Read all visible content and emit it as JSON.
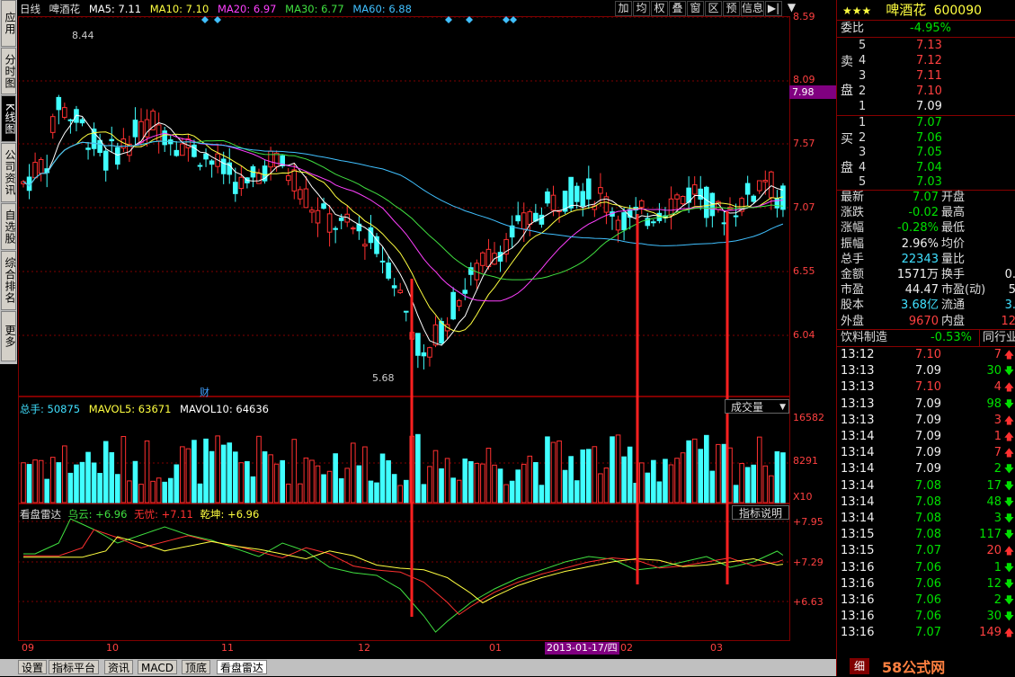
{
  "left_tabs": [
    "应用",
    "分时图",
    "K线图",
    "公司资讯",
    "自选股",
    "综合排名",
    "更多"
  ],
  "chart": {
    "period_label": "日线",
    "stock_name": "啤酒花",
    "ma": [
      {
        "label": "MA5: 7.11",
        "color": "#ffffff"
      },
      {
        "label": "MA10: 7.10",
        "color": "#ffff40"
      },
      {
        "label": "MA20: 6.97",
        "color": "#ff40ff"
      },
      {
        "label": "MA30: 6.77",
        "color": "#40e040"
      },
      {
        "label": "MA60: 6.88",
        "color": "#40c0ff"
      }
    ],
    "toolbar": [
      "加",
      "均",
      "权",
      "叠",
      "窗",
      "区",
      "预",
      "信息",
      "▶|",
      "▼"
    ],
    "price_axis": [
      "8.59",
      "8.09",
      "7.98",
      "7.57",
      "7.07",
      "6.55",
      "6.04"
    ],
    "current_price_box": "7.98",
    "high_label": "8.44",
    "low_label": "5.68",
    "cai_label": "财",
    "volume_legend": {
      "total": "总手: 50875",
      "mavol5": "MAVOL5: 63671",
      "mavol10": "MAVOL10: 64636"
    },
    "volume_dropdown": "成交量",
    "volume_axis": [
      "16582",
      "8291",
      "X10"
    ],
    "indicator_legend": {
      "name": "看盘雷达",
      "wuyun": "乌云: +6.96",
      "wuyou": "无忧: +7.11",
      "qiankun": "乾坤: +6.96"
    },
    "indicator_button": "指标说明",
    "indicator_axis": [
      "+7.95",
      "+7.29",
      "+6.63"
    ],
    "x_axis": [
      "09",
      "10",
      "11",
      "12",
      "01",
      "02",
      "03"
    ],
    "date_cursor": "2013-01-17/四"
  },
  "bottom_tabs": [
    "设置",
    "指标平台",
    "资讯",
    "MACD",
    "顶底",
    "看盘雷达"
  ],
  "panel": {
    "title": "啤酒花",
    "code": "600090",
    "weibi_label": "委比",
    "weibi_value": "-4.95%",
    "sell_label": [
      "卖",
      "盘"
    ],
    "buy_label": [
      "买",
      "盘"
    ],
    "asks": [
      {
        "n": "5",
        "p": "7.13"
      },
      {
        "n": "4",
        "p": "7.12"
      },
      {
        "n": "3",
        "p": "7.11"
      },
      {
        "n": "2",
        "p": "7.10"
      },
      {
        "n": "1",
        "p": "7.09"
      }
    ],
    "bids": [
      {
        "n": "1",
        "p": "7.07"
      },
      {
        "n": "2",
        "p": "7.06"
      },
      {
        "n": "3",
        "p": "7.05"
      },
      {
        "n": "4",
        "p": "7.04"
      },
      {
        "n": "5",
        "p": "7.03"
      }
    ],
    "stats": [
      {
        "l": "最新",
        "v": "7.07",
        "r": "开盘",
        "c": "grn"
      },
      {
        "l": "涨跌",
        "v": "-0.02",
        "r": "最高",
        "c": "grn"
      },
      {
        "l": "涨幅",
        "v": "-0.28%",
        "r": "最低",
        "c": "grn"
      },
      {
        "l": "振幅",
        "v": "2.96%",
        "r": "均价",
        "c": "wht"
      },
      {
        "l": "总手",
        "v": "22343",
        "r": "量比",
        "c": "cyan"
      },
      {
        "l": "金额",
        "v": "1571万",
        "r": "换手",
        "c": "wht",
        "extra": "0."
      },
      {
        "l": "市盈",
        "v": "44.47",
        "r": "市盈(动)",
        "c": "wht",
        "extra": "5"
      },
      {
        "l": "股本",
        "v": "3.68亿",
        "r": "流通",
        "c": "cyan",
        "extra": "3."
      },
      {
        "l": "外盘",
        "v": "9670",
        "r": "内盘",
        "c": "red",
        "extra": "12"
      }
    ],
    "industry": {
      "name": "饮料制造",
      "change": "-0.53%",
      "link": "同行业比"
    },
    "ticks": [
      {
        "t": "13:12",
        "p": "7.10",
        "v": "7",
        "d": "up"
      },
      {
        "t": "13:13",
        "p": "7.09",
        "v": "30",
        "d": "down"
      },
      {
        "t": "13:13",
        "p": "7.10",
        "v": "4",
        "d": "up"
      },
      {
        "t": "13:13",
        "p": "7.09",
        "v": "98",
        "d": "down"
      },
      {
        "t": "13:13",
        "p": "7.09",
        "v": "3",
        "d": "up"
      },
      {
        "t": "13:14",
        "p": "7.09",
        "v": "1",
        "d": "up"
      },
      {
        "t": "13:14",
        "p": "7.09",
        "v": "7",
        "d": "up"
      },
      {
        "t": "13:14",
        "p": "7.09",
        "v": "2",
        "d": "down"
      },
      {
        "t": "13:14",
        "p": "7.08",
        "v": "17",
        "d": "down"
      },
      {
        "t": "13:14",
        "p": "7.08",
        "v": "48",
        "d": "down"
      },
      {
        "t": "13:14",
        "p": "7.08",
        "v": "3",
        "d": "down"
      },
      {
        "t": "13:15",
        "p": "7.08",
        "v": "117",
        "d": "down"
      },
      {
        "t": "13:15",
        "p": "7.07",
        "v": "20",
        "d": "up"
      },
      {
        "t": "13:16",
        "p": "7.06",
        "v": "1",
        "d": "down"
      },
      {
        "t": "13:16",
        "p": "7.06",
        "v": "12",
        "d": "down"
      },
      {
        "t": "13:16",
        "p": "7.06",
        "v": "2",
        "d": "down"
      },
      {
        "t": "13:16",
        "p": "7.06",
        "v": "30",
        "d": "down"
      },
      {
        "t": "13:16",
        "p": "7.07",
        "v": "149",
        "d": "up"
      }
    ],
    "watermark": "58公式网",
    "detail_btn": "细"
  },
  "colors": {
    "up": "#ff3030",
    "down": "#40ffff",
    "grid": "#800000",
    "bg": "#000000"
  }
}
